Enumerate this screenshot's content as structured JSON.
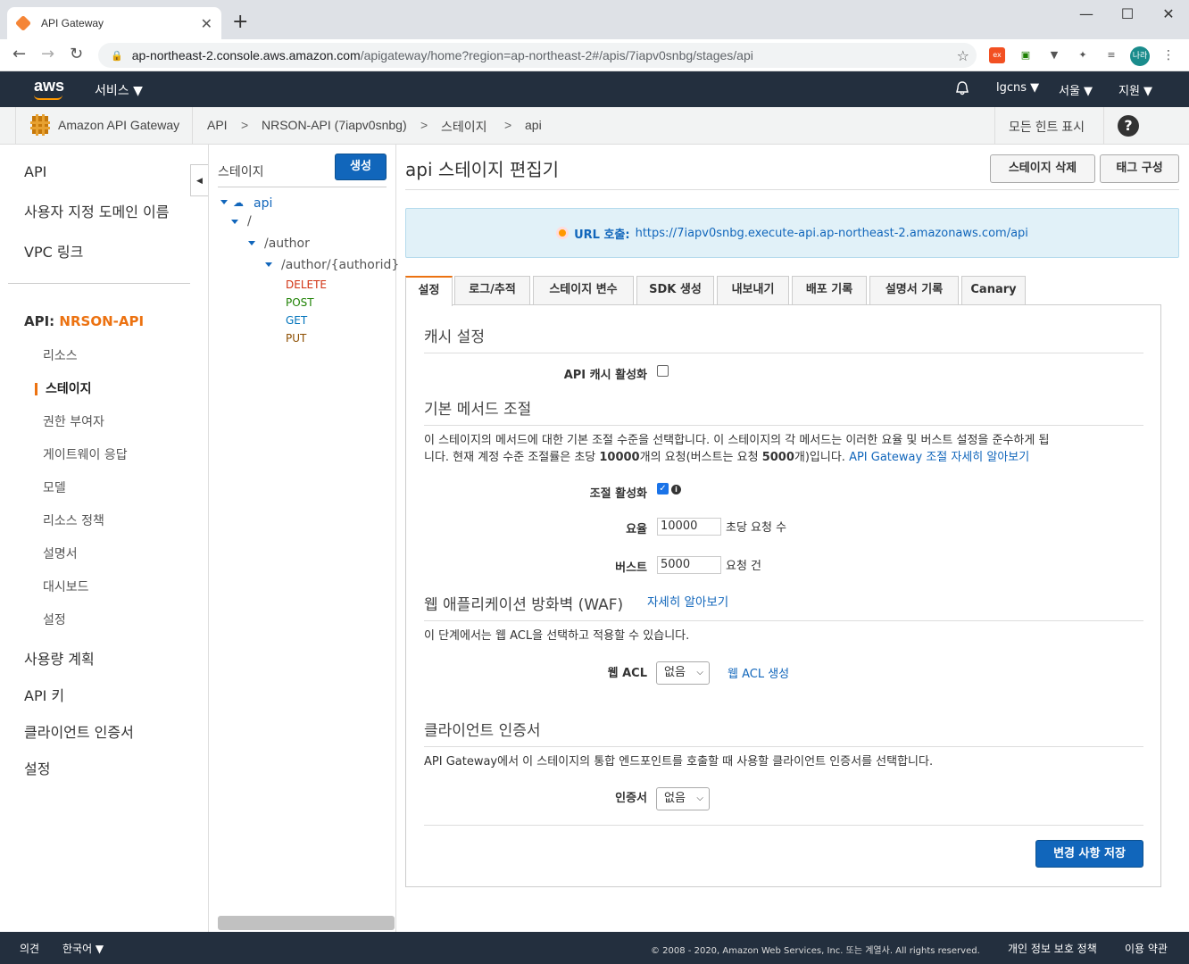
{
  "browser": {
    "tab_title": "API Gateway",
    "url_host": "ap-northeast-2.console.aws.amazon.com",
    "url_path": "/apigateway/home?region=ap-northeast-2#/apis/7iapv0snbg/stages/api",
    "profile": "나라"
  },
  "aws_nav": {
    "logo": "aws",
    "services": "서비스 ▼",
    "account": "lgcns ▼",
    "region": "서울 ▼",
    "support": "지원 ▼"
  },
  "breadcrumb": {
    "service": "Amazon API Gateway",
    "items": [
      "API",
      "NRSON-API (7iapv0snbg)",
      "스테이지",
      "api"
    ],
    "hints": "모든 힌트 표시"
  },
  "sidebar": {
    "top": [
      "API",
      "사용자 지정 도메인 이름",
      "VPC 링크"
    ],
    "api_prefix": "API:",
    "api_name": "NRSON-API",
    "sub": [
      "리소스",
      "스테이지",
      "권한 부여자",
      "게이트웨이 응답",
      "모델",
      "리소스 정책",
      "설명서",
      "대시보드",
      "설정"
    ],
    "bottom": [
      "사용량 계획",
      "API 키",
      "클라이언트 인증서",
      "설정"
    ]
  },
  "stages_panel": {
    "title": "스테이지",
    "create": "생성",
    "tree": {
      "stage": "api",
      "root": "/",
      "author": "/author",
      "author_id": "/author/{authorid}",
      "methods": [
        "DELETE",
        "POST",
        "GET",
        "PUT"
      ]
    }
  },
  "main": {
    "title": "api 스테이지 편집기",
    "delete_btn": "스테이지 삭제",
    "tags_btn": "태그 구성",
    "invoke_label": "URL 호출:",
    "invoke_url": "https://7iapv0snbg.execute-api.ap-northeast-2.amazonaws.com/api",
    "tabs": [
      "설정",
      "로그/추적",
      "스테이지 변수",
      "SDK 생성",
      "내보내기",
      "배포 기록",
      "설명서 기록",
      "Canary"
    ],
    "cache": {
      "heading": "캐시 설정",
      "label": "API 캐시 활성화"
    },
    "throttle": {
      "heading": "기본 메서드 조절",
      "desc1": "이 스테이지의 메서드에 대한 기본 조절 수준을 선택합니다. 이 스테이지의 각 메서드는 이러한 요율 및 버스트 설정을 준수하게 됩",
      "desc2a": "니다. 현재 계정 수준 조절률은 초당 ",
      "desc2_rate": "10000",
      "desc2b": "개의 요청(버스트는 요청 ",
      "desc2_burst": "5000",
      "desc2c": "개)입니다. ",
      "learn_more": "API Gateway 조절 자세히 알아보기",
      "enable_label": "조절 활성화",
      "rate_label": "요율",
      "rate_value": "10000",
      "rate_unit": "초당 요청 수",
      "burst_label": "버스트",
      "burst_value": "5000",
      "burst_unit": "요청 건"
    },
    "waf": {
      "heading": "웹 애플리케이션 방화벽 (WAF)",
      "learn_more": "자세히 알아보기",
      "desc": "이 단계에서는 웹 ACL을 선택하고 적용할 수 있습니다.",
      "acl_label": "웹 ACL",
      "acl_value": "없음",
      "create_acl": "웹 ACL 생성"
    },
    "client_cert": {
      "heading": "클라이언트 인증서",
      "desc": "API Gateway에서 이 스테이지의 통합 엔드포인트를 호출할 때 사용할 클라이언트 인증서를 선택합니다.",
      "label": "인증서",
      "value": "없음"
    },
    "save": "변경 사항 저장"
  },
  "footer": {
    "feedback": "의견",
    "language": "한국어 ▼",
    "copyright": "© 2008 - 2020, Amazon Web Services, Inc. 또는 계열사. All rights reserved.",
    "privacy": "개인 정보 보호 정책",
    "terms": "이용 약관"
  },
  "colors": {
    "aws_dark": "#232f3e",
    "accent_orange": "#ec7211",
    "link_blue": "#1166bb",
    "delete": "#d13212",
    "post": "#1d8102",
    "get": "#0073bb",
    "put": "#8c4e00"
  }
}
